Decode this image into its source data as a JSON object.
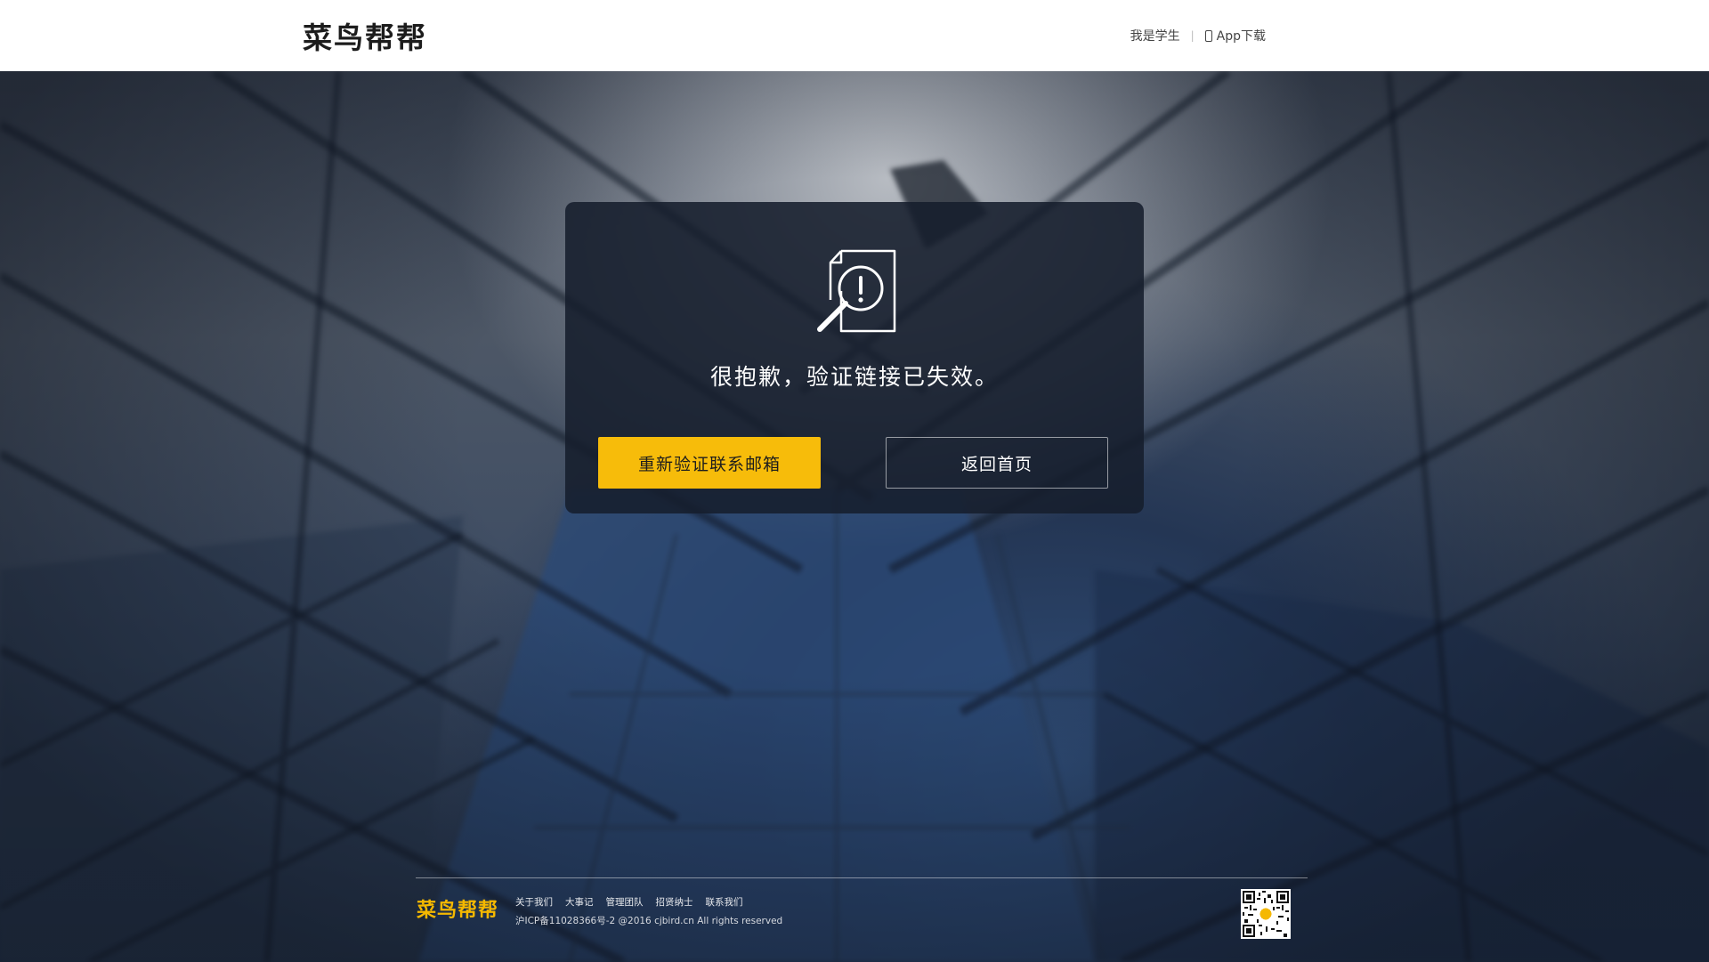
{
  "header": {
    "logo_text": "菜鸟帮帮",
    "nav": {
      "student_link": "我是学生",
      "separator": "|",
      "app_download": "App下载"
    }
  },
  "card": {
    "icon": "document-alert-icon",
    "message": "很抱歉，验证链接已失效。",
    "primary_button": "重新验证联系邮箱",
    "secondary_button": "返回首页"
  },
  "footer": {
    "logo_text": "菜鸟帮帮",
    "links": [
      "关于我们",
      "大事记",
      "管理团队",
      "招贤纳士",
      "联系我们"
    ],
    "copyright": "沪ICP备11028366号-2 @2016 cjbird.cn All rights reserved",
    "qr_icon": "qr-code-icon"
  },
  "colors": {
    "accent": "#f7bc0a",
    "card_bg": "#161e2c",
    "header_bg": "#ffffff"
  }
}
